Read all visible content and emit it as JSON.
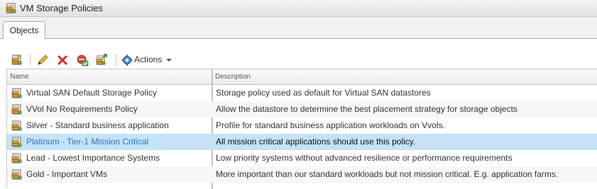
{
  "window": {
    "title": "VM Storage Policies",
    "icon": "storage-policy-icon"
  },
  "tabs": [
    {
      "label": "Objects",
      "active": true
    }
  ],
  "toolbar": {
    "buttons": [
      {
        "name": "create-policy-button",
        "icon": "new-storage-policy-icon"
      },
      {
        "name": "edit-policy-button",
        "icon": "pencil-icon"
      },
      {
        "name": "delete-policy-button",
        "icon": "red-x-icon"
      },
      {
        "name": "check-compliance-button",
        "icon": "check-compliance-icon"
      },
      {
        "name": "clone-policy-button",
        "icon": "clone-policy-icon"
      }
    ],
    "actions_label": "Actions",
    "actions_icon": "gear-icon"
  },
  "table": {
    "columns": {
      "name": "Name",
      "description": "Description"
    },
    "rows": [
      {
        "name": "Virtual SAN Default Storage Policy",
        "description": "Storage policy used as default for Virtual SAN datastores"
      },
      {
        "name": "VVol No Requirements Policy",
        "description": "Allow the datastore to determine the best placement strategy for storage objects"
      },
      {
        "name": "Silver - Standard business application",
        "description": "Profile for standard business application workloads on Vvols."
      },
      {
        "name": "Platinum - Tier-1 Mission Critical",
        "description": "All mission critical applications should use this policy."
      },
      {
        "name": "Lead - Lowest Importance Systems",
        "description": "Low priority systems without advanced resilience or performance requirements"
      },
      {
        "name": "Gold - Important VMs",
        "description": "More important than our standard workloads but not mission critical.  E.g. application farms."
      }
    ],
    "selected_row": "Platinum - Tier-1 Mission Critical"
  },
  "colors": {
    "selected_row_bg": "#c5e3f7",
    "selected_text": "#2b73b8",
    "alt_row_bg": "#f7f7f7",
    "delete_red": "#d92b1d"
  }
}
